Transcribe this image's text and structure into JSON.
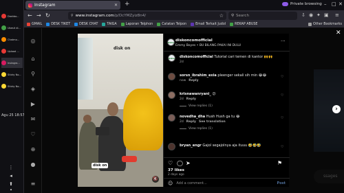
{
  "taskbar": {
    "apps": [
      {
        "label": "Dashbo...",
        "color": "#e53935"
      },
      {
        "label": "Ubesit di...",
        "color": "#43a047"
      },
      {
        "label": "Chatmo...",
        "color": "#fb8c00"
      },
      {
        "label": "Upload ...",
        "color": "#e53935"
      },
      {
        "label": "Instagra...",
        "color": "#d81b60"
      },
      {
        "label": "Sticky No...",
        "color": "#fdd835"
      },
      {
        "label": "Sticky No...",
        "color": "#fdd835"
      }
    ],
    "clock": "Agu 25  18:57"
  },
  "browser": {
    "tab_title": "Instagram",
    "private_label": "Private browsing",
    "url_host": "www.instagram.com",
    "url_path": "/p/DcYMZyiz8n4/",
    "search_placeholder": "Search",
    "bookmarks": [
      {
        "label": "GMAIL",
        "color": "#ea4335"
      },
      {
        "label": "DESK TIKET",
        "color": "#1e88e5"
      },
      {
        "label": "DESK CHAT",
        "color": "#1e88e5"
      },
      {
        "label": "TAIGA",
        "color": "#26a69a"
      },
      {
        "label": "Laporan Telphon",
        "color": "#43a047"
      },
      {
        "label": "Catatan Telpon",
        "color": "#43a047"
      },
      {
        "label": "Email Terkait Judol",
        "color": "#5e35b1"
      },
      {
        "label": "REKAP ABUSE",
        "color": "#43a047"
      }
    ],
    "other_bookmarks": "Other Bookmarks"
  },
  "post": {
    "brand_logo": "disk on",
    "author": "diskoncomofficial",
    "audio": "Emmy Boyes • BU BILANG PAKAI INI DULU",
    "avatar_text": "diskon",
    "comments": [
      {
        "user": "diskoncomofficial",
        "text": "Tutorial cari temen di kantor 🙌🙌",
        "time": "2d",
        "reply": "",
        "extra": "",
        "view_replies": ""
      },
      {
        "user": "sorsn_ibrahim_exia",
        "text": "pleenger sekali sih min 😂😂",
        "time": "now",
        "reply": "Reply",
        "extra": "",
        "view_replies": ""
      },
      {
        "user": "krisnawanryani_",
        "text": "😕",
        "time": "2d",
        "reply": "Reply",
        "extra": "",
        "view_replies": "View replies (1)"
      },
      {
        "user": "novedha_dha",
        "text": "Hush Hush ga tu 😂",
        "time": "2d",
        "reply": "Reply",
        "extra": "See translation",
        "view_replies": "View replies (1)"
      },
      {
        "user": "bryan_engr",
        "text": "Gajol segajolnya aja ituuu 🤣🤣🤣",
        "time": "",
        "reply": "",
        "extra": "",
        "view_replies": ""
      }
    ],
    "likes": "37 likes",
    "posted": "2 days ago",
    "add_comment_placeholder": "Add a comment...",
    "post_label": "Post"
  },
  "background": {
    "message_label": "ssages"
  }
}
